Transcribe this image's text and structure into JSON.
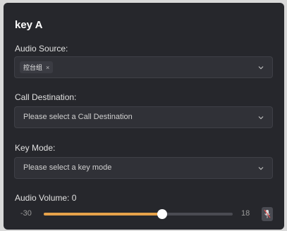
{
  "panel": {
    "title": "key A"
  },
  "audio_source": {
    "label": "Audio Source:",
    "tags": [
      {
        "text": "控台组",
        "remove_glyph": "×"
      }
    ],
    "dropdown_icon": "chevron-down-icon"
  },
  "call_destination": {
    "label": "Call Destination:",
    "placeholder": "Please select a Call Destination",
    "dropdown_icon": "chevron-down-icon"
  },
  "key_mode": {
    "label": "Key Mode:",
    "placeholder": "Please select a key mode",
    "dropdown_icon": "chevron-down-icon"
  },
  "audio_volume": {
    "label": "Audio Volume: 0",
    "min_label": "-30",
    "max_label": "18",
    "min": -30,
    "max": 18,
    "value": 0,
    "mic_icon": "microphone-muted-icon"
  },
  "colors": {
    "panel_bg": "#26272c",
    "field_bg": "#303137",
    "accent": "#e6a24a"
  }
}
